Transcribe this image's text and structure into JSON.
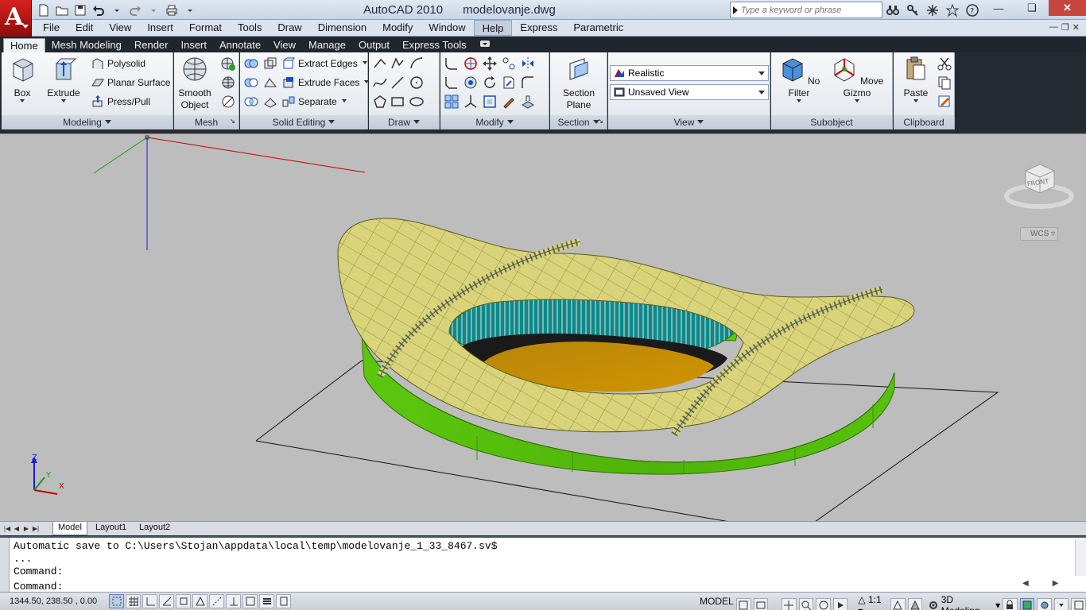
{
  "app": {
    "logo_letter": "A",
    "title": "AutoCAD 2010",
    "document": "modelovanje.dwg"
  },
  "search": {
    "placeholder": "Type a keyword or phrase"
  },
  "menu": [
    "File",
    "Edit",
    "View",
    "Insert",
    "Format",
    "Tools",
    "Draw",
    "Dimension",
    "Modify",
    "Window",
    "Help",
    "Express",
    "Parametric"
  ],
  "menu_active": "Help",
  "ribbon_tabs": [
    "Home",
    "Mesh Modeling",
    "Render",
    "Insert",
    "Annotate",
    "View",
    "Manage",
    "Output",
    "Express Tools"
  ],
  "ribbon_active_tab": "Home",
  "panels": {
    "modeling": {
      "title": "Modeling",
      "box": "Box",
      "extrude": "Extrude",
      "polysolid": "Polysolid",
      "planar_surface": "Planar Surface",
      "press_pull": "Press/Pull"
    },
    "mesh": {
      "title": "Mesh",
      "smooth_line1": "Smooth",
      "smooth_line2": "Object"
    },
    "solid_editing": {
      "title": "Solid Editing",
      "extract_edges": "Extract Edges",
      "extrude_faces": "Extrude Faces",
      "separate": "Separate"
    },
    "draw": {
      "title": "Draw"
    },
    "modify": {
      "title": "Modify"
    },
    "section": {
      "title": "Section",
      "plane_line1": "Section",
      "plane_line2": "Plane"
    },
    "view": {
      "title": "View",
      "visual_style": "Realistic",
      "named_view": "Unsaved View"
    },
    "subobject": {
      "title": "Subobject",
      "no_filter": "No Filter",
      "move_gizmo": "Move Gizmo"
    },
    "clipboard": {
      "title": "Clipboard",
      "paste": "Paste"
    }
  },
  "viewport": {
    "viewcube_face": "FRONT",
    "wcs_label": "WCS",
    "ucs_axes": {
      "x": "X",
      "y": "Y",
      "z": "Z"
    }
  },
  "layout_tabs": [
    "Model",
    "Layout1",
    "Layout2"
  ],
  "command": {
    "lines": [
      "Automatic save to C:\\Users\\Stojan\\appdata\\local\\temp\\modelovanje_1_33_8467.sv$",
      "...",
      "Command:"
    ],
    "prompt": "Command:"
  },
  "status": {
    "coords": "1344.50, 238.50 , 0.00",
    "model": "MODEL",
    "scale": "1:1",
    "workspace": "3D Modeling"
  },
  "colors": {
    "stadium_wall": "#5cc70f",
    "roof": "#d9d47a",
    "field": "#c98c00",
    "seats": "#0a8a8a",
    "viewport_bg": "#bdbdbd",
    "axis_x": "#c00000",
    "axis_y": "#1a9a1a",
    "axis_z": "#1a1ad0"
  }
}
